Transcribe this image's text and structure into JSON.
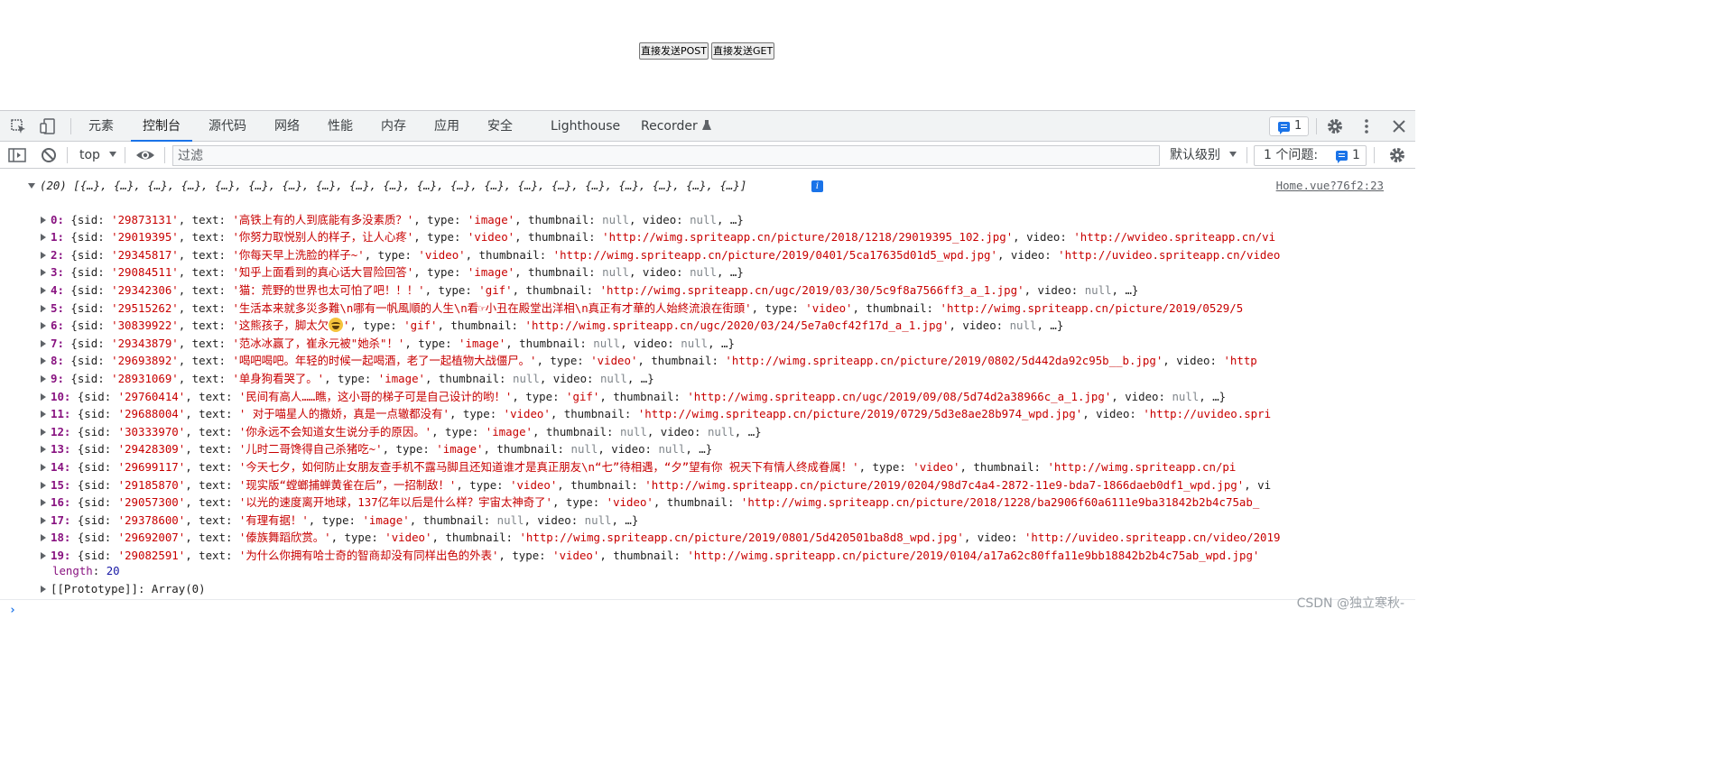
{
  "page": {
    "btn_post": "直接发送POST",
    "btn_get": "直接发送GET"
  },
  "devtools": {
    "tabs": [
      "元素",
      "控制台",
      "源代码",
      "网络",
      "性能",
      "内存",
      "应用",
      "安全",
      "Lighthouse",
      "Recorder"
    ],
    "active_tab": "控制台",
    "issues_count": "1",
    "toolbar": {
      "context": "top",
      "filter_placeholder": "过滤",
      "level": "默认级别",
      "issues_label": "1 个问题:",
      "issues_count": "1"
    }
  },
  "console": {
    "source_link": "Home.vue?76f2:23",
    "array_summary": "(20) [{…}, {…}, {…}, {…}, {…}, {…}, {…}, {…}, {…}, {…}, {…}, {…}, {…}, {…}, {…}, {…}, {…}, {…}, {…}, {…}]",
    "rows": [
      {
        "idx": "0:",
        "sid": "'29873131'",
        "text": "'高铁上有的人到底能有多没素质？'",
        "type": "'image'",
        "thumbnail": "null",
        "video": "null",
        "tail": ", …}"
      },
      {
        "idx": "1:",
        "sid": "'29019395'",
        "text": "'你努力取悦别人的样子，让人心疼'",
        "type": "'video'",
        "thumbnail": "'http://wimg.spriteapp.cn/picture/2018/1218/29019395_102.jpg'",
        "video": "'http://wvideo.spriteapp.cn/vi",
        "tail": ""
      },
      {
        "idx": "2:",
        "sid": "'29345817'",
        "text": "'你每天早上洗脸的样子~'",
        "type": "'video'",
        "thumbnail": "'http://wimg.spriteapp.cn/picture/2019/0401/5ca17635d01d5_wpd.jpg'",
        "video": "'http://uvideo.spriteapp.cn/video",
        "tail": ""
      },
      {
        "idx": "3:",
        "sid": "'29084511'",
        "text": "'知乎上面看到的真心话大冒险回答'",
        "type": "'image'",
        "thumbnail": "null",
        "video": "null",
        "tail": ", …}"
      },
      {
        "idx": "4:",
        "sid": "'29342306'",
        "text": "'猫：荒野的世界也太可怕了吧！！！'",
        "type": "'gif'",
        "thumbnail": "'http://wimg.spriteapp.cn/ugc/2019/03/30/5c9f8a7566ff3_a_1.jpg'",
        "video": "null",
        "tail": ", …}"
      },
      {
        "idx": "5:",
        "sid": "'29515262'",
        "text": "'生活本来就多災多難\\n哪有一帆風順的人生\\n看☞小丑在殿堂出洋相\\n真正有才華的人始終流浪在街頭'",
        "type": "'video'",
        "thumbnail": "'http://wimg.spriteapp.cn/picture/2019/0529/5",
        "video": "",
        "tail": ""
      },
      {
        "idx": "6:",
        "sid": "'30839922'",
        "text": "'这熊孩子，脚太欠",
        "type": "'gif'",
        "thumbnail": "'http://wimg.spriteapp.cn/ugc/2020/03/24/5e7a0cf42f17d_a_1.jpg'",
        "video": "null",
        "tail": ", …}"
      },
      {
        "idx": "7:",
        "sid": "'29343879'",
        "text": "'范冰冰赢了，崔永元被\"她杀\"！'",
        "type": "'image'",
        "thumbnail": "null",
        "video": "null",
        "tail": ", …}"
      },
      {
        "idx": "8:",
        "sid": "'29693892'",
        "text": "'喝吧喝吧。年轻的时候一起喝酒，老了一起植物大战僵尸。'",
        "type": "'video'",
        "thumbnail": "'http://wimg.spriteapp.cn/picture/2019/0802/5d442da92c95b__b.jpg'",
        "video": "'http",
        "tail": ""
      },
      {
        "idx": "9:",
        "sid": "'28931069'",
        "text": "'单身狗看哭了。'",
        "type": "'image'",
        "thumbnail": "null",
        "video": "null",
        "tail": ", …}"
      },
      {
        "idx": "10:",
        "sid": "'29760414'",
        "text": "'民间有高人……瞧，这小哥的梯子可是自己设计的哟！'",
        "type": "'gif'",
        "thumbnail": "'http://wimg.spriteapp.cn/ugc/2019/09/08/5d74d2a38966c_a_1.jpg'",
        "video": "null",
        "tail": ", …}"
      },
      {
        "idx": "11:",
        "sid": "'29688004'",
        "text": "' 对于喵星人的撒娇，真是一点辙都没有'",
        "type": "'video'",
        "thumbnail": "'http://wimg.spriteapp.cn/picture/2019/0729/5d3e8ae28b974_wpd.jpg'",
        "video": "'http://uvideo.spri",
        "tail": ""
      },
      {
        "idx": "12:",
        "sid": "'30333970'",
        "text": "'你永远不会知道女生说分手的原因。'",
        "type": "'image'",
        "thumbnail": "null",
        "video": "null",
        "tail": ", …}"
      },
      {
        "idx": "13:",
        "sid": "'29428309'",
        "text": "'儿时二哥馋得自己杀猪吃~'",
        "type": "'image'",
        "thumbnail": "null",
        "video": "null",
        "tail": ", …}"
      },
      {
        "idx": "14:",
        "sid": "'29699117'",
        "text": "'今天七夕，如何防止女朋友查手机不露马脚且还知道谁才是真正朋友\\n“七”待相遇，“夕”望有你 祝天下有情人终成眷属！'",
        "type": "'video'",
        "thumbnail": "'http://wimg.spriteapp.cn/pi",
        "video": "",
        "tail": ""
      },
      {
        "idx": "15:",
        "sid": "'29185870'",
        "text": "'现实版“螳螂捕蝉黄雀在后”，一招制敌！'",
        "type": "'video'",
        "thumbnail": "'http://wimg.spriteapp.cn/picture/2019/0204/98d7c4a4-2872-11e9-bda7-1866daeb0df1_wpd.jpg'",
        "video": "vi",
        "tail": ""
      },
      {
        "idx": "16:",
        "sid": "'29057300'",
        "text": "'以光的速度离开地球，137亿年以后是什么样？宇宙太神奇了'",
        "type": "'video'",
        "thumbnail": "'http://wimg.spriteapp.cn/picture/2018/1228/ba2906f60a6111e9ba31842b2b4c75ab_",
        "video": "",
        "tail": ""
      },
      {
        "idx": "17:",
        "sid": "'29378600'",
        "text": "'有理有据！'",
        "type": "'image'",
        "thumbnail": "null",
        "video": "null",
        "tail": ", …}"
      },
      {
        "idx": "18:",
        "sid": "'29692007'",
        "text": "'傣族舞蹈欣赏。'",
        "type": "'video'",
        "thumbnail": "'http://wimg.spriteapp.cn/picture/2019/0801/5d420501ba8d8_wpd.jpg'",
        "video": "'http://uvideo.spriteapp.cn/video/2019",
        "tail": ""
      },
      {
        "idx": "19:",
        "sid": "'29082591'",
        "text": "'为什么你拥有哈士奇的智商却没有同样出色的外表'",
        "type": "'video'",
        "thumbnail": "'http://wimg.spriteapp.cn/picture/2019/0104/a17a62c80ffa11e9bb18842b2b4c75ab_wpd.jpg'",
        "video": "",
        "tail": ""
      }
    ],
    "length_label": "length",
    "length_value": "20",
    "prototype_label": "[[Prototype]]",
    "prototype_value": "Array(0)"
  },
  "watermark": "CSDN @独立寒秋-"
}
